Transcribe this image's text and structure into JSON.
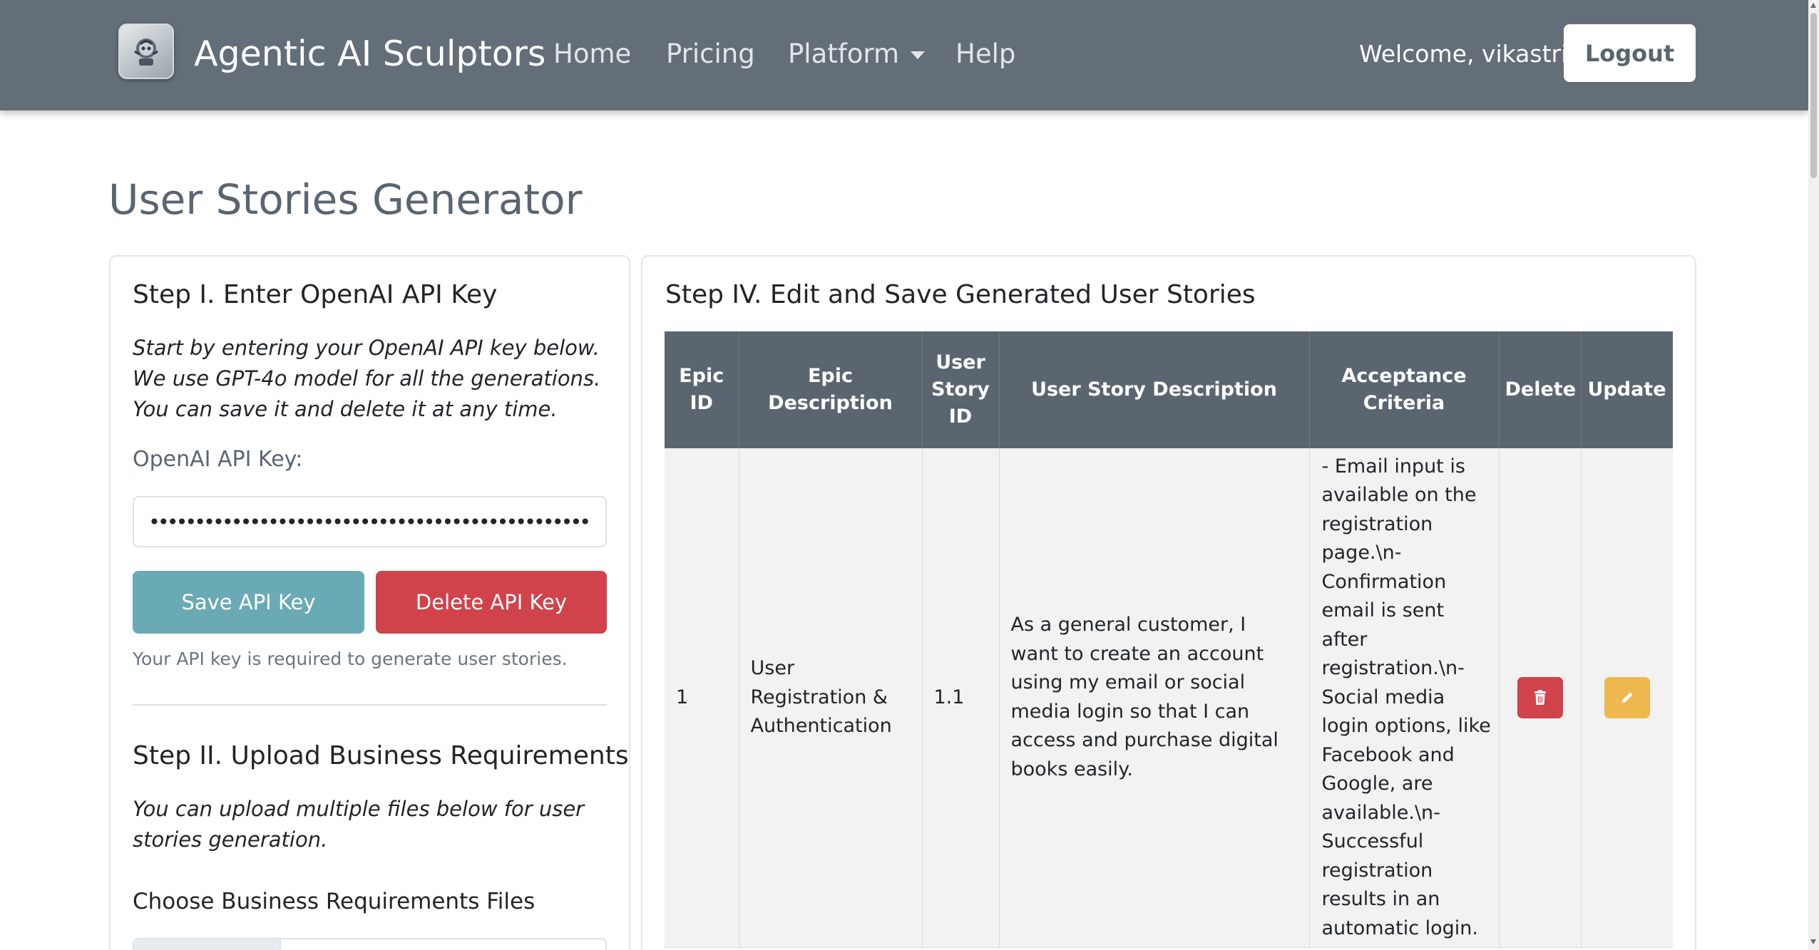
{
  "navbar": {
    "brand": "Agentic AI Sculptors",
    "links": [
      {
        "label": "Home"
      },
      {
        "label": "Pricing"
      },
      {
        "label": "Platform"
      },
      {
        "label": "Help"
      }
    ],
    "welcome": "Welcome, vikastri!",
    "logout_label": "Logout"
  },
  "page": {
    "title": "User Stories Generator"
  },
  "left_panel": {
    "step1": {
      "heading": "Step I. Enter OpenAI API Key",
      "description": "Start by entering your OpenAI API key below. We use GPT-4o model for all the generations. You can save it and delete it at any time.",
      "label": "OpenAI API Key:",
      "api_key_value": "••••••••••••••••••••••••••••••••••••••••••••••••••••••••••••",
      "save_label": "Save API Key",
      "delete_label": "Delete API Key",
      "help": "Your API key is required to generate user stories."
    },
    "step2": {
      "heading": "Step II. Upload Business Requirements",
      "description": "You can upload multiple files below for user stories generation.",
      "files_label": "Choose Business Requirements Files"
    }
  },
  "right_panel": {
    "heading": "Step IV. Edit and Save Generated User Stories",
    "table": {
      "columns": [
        "Epic ID",
        "Epic Description",
        "User Story ID",
        "User Story Description",
        "Acceptance Criteria",
        "Delete",
        "Update"
      ],
      "rows": [
        {
          "epic_id": "1",
          "epic_description": "User Registration & Authentication",
          "user_story_id": "1.1",
          "user_story_description": "As a general customer, I want to create an account using my email or social media login so that I can access and purchase digital books easily.",
          "acceptance_criteria": "- Email input is available on the registration page.\\n- Confirmation email is sent after registration.\\n- Social media login options, like Facebook and Google, are available.\\n- Successful registration results in an automatic login."
        }
      ]
    }
  },
  "colors": {
    "navbar": "#646e78",
    "table_header": "#5a6570",
    "save_button": "#6aaab4",
    "delete_button": "#d0434a",
    "update_button": "#efb84e"
  },
  "icons": {
    "brand": "robot-logo-icon",
    "platform_dropdown": "chevron-down-icon",
    "delete": "trash-icon",
    "update": "pencil-icon"
  }
}
